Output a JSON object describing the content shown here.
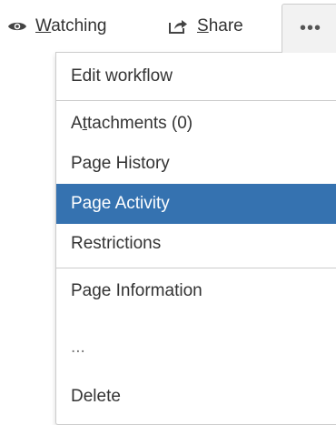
{
  "toolbar": {
    "watch": {
      "label_prefix": "",
      "label_accent": "W",
      "label_rest": "atching",
      "icon": "eye-icon"
    },
    "share": {
      "label_prefix": "",
      "label_accent": "S",
      "label_rest": "hare",
      "icon": "share-icon"
    },
    "more": {
      "label": "•••",
      "icon": "more-dots-icon"
    }
  },
  "menu": {
    "groups": [
      {
        "items": [
          {
            "label": "Edit workflow"
          }
        ]
      },
      {
        "items": [
          {
            "label_prefix": "A",
            "label_accent": "t",
            "label_rest": "tachments (0)"
          },
          {
            "label": "Page History"
          },
          {
            "label": "Page Activity",
            "active": true
          },
          {
            "label": "Restrictions"
          }
        ]
      },
      {
        "items": [
          {
            "label": "Page Information"
          },
          {
            "label": "..."
          },
          {
            "label": "Delete"
          }
        ]
      }
    ]
  },
  "colors": {
    "active_bg": "#3572b0",
    "active_text": "#ffffff",
    "text": "#333333",
    "border": "#cccccc"
  }
}
